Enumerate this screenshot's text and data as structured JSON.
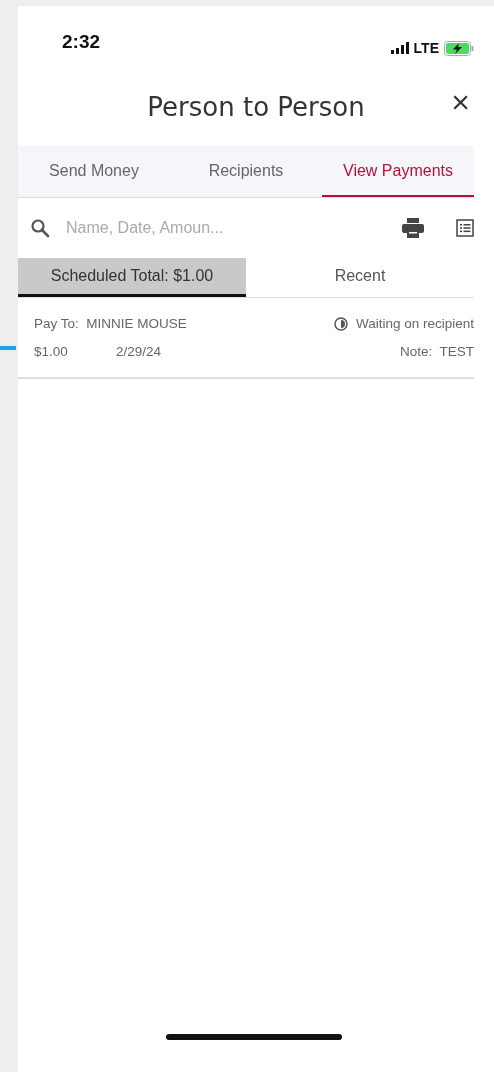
{
  "status_bar": {
    "time": "2:32",
    "network": "LTE"
  },
  "header": {
    "title": "Person to Person",
    "close": "×"
  },
  "tabs": [
    {
      "label": "Send Money",
      "selected": false
    },
    {
      "label": "Recipients",
      "selected": false
    },
    {
      "label": "View Payments",
      "selected": true
    }
  ],
  "search": {
    "placeholder": "Name, Date, Amoun..."
  },
  "subtabs": [
    {
      "label": "Scheduled Total: $1.00",
      "selected": true
    },
    {
      "label": "Recent",
      "selected": false
    }
  ],
  "payments": [
    {
      "pay_to_label": "Pay To:",
      "payee": "MINNIE MOUSE",
      "status": "Waiting on recipient",
      "amount": "$1.00",
      "date": "2/29/24",
      "note_label": "Note:",
      "note": "TEST"
    }
  ]
}
